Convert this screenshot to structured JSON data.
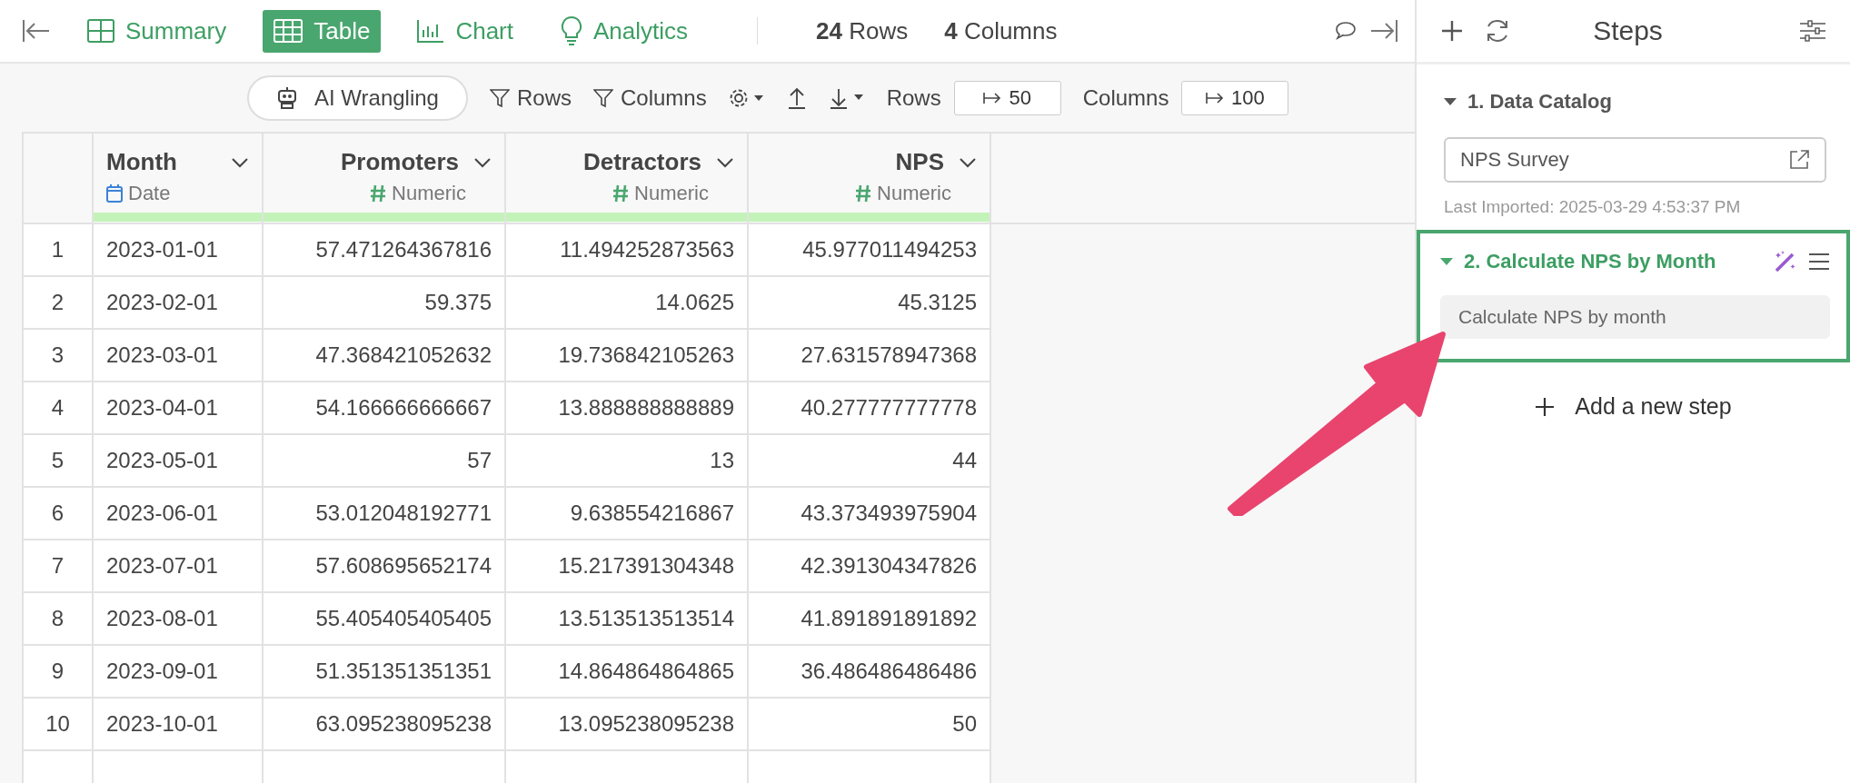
{
  "view_tabs": [
    {
      "label": "Summary",
      "kind": "summary",
      "selected": false
    },
    {
      "label": "Table",
      "kind": "table",
      "selected": true
    },
    {
      "label": "Chart",
      "kind": "chart",
      "selected": false
    },
    {
      "label": "Analytics",
      "kind": "analytics",
      "selected": false
    }
  ],
  "counts": {
    "rows_count": "24",
    "rows_label": "Rows",
    "columns_count": "4",
    "columns_label": "Columns"
  },
  "toolbar": {
    "ai_button": "AI Wrangling",
    "row_filter": "Rows",
    "column_filter": "Columns",
    "rows_label": "Rows",
    "rows_limit": "50",
    "columns_label": "Columns",
    "columns_limit": "100"
  },
  "table": {
    "columns": [
      {
        "name": "Month",
        "type": "Date",
        "kind": "date"
      },
      {
        "name": "Promoters",
        "type": "Numeric",
        "kind": "numeric"
      },
      {
        "name": "Detractors",
        "type": "Numeric",
        "kind": "numeric"
      },
      {
        "name": "NPS",
        "type": "Numeric",
        "kind": "numeric"
      }
    ],
    "rows": [
      {
        "number": "1",
        "cells": [
          "2023-01-01",
          "57.471264367816",
          "11.494252873563",
          "45.977011494253"
        ]
      },
      {
        "number": "2",
        "cells": [
          "2023-02-01",
          "59.375",
          "14.0625",
          "45.3125"
        ]
      },
      {
        "number": "3",
        "cells": [
          "2023-03-01",
          "47.368421052632",
          "19.736842105263",
          "27.631578947368"
        ]
      },
      {
        "number": "4",
        "cells": [
          "2023-04-01",
          "54.166666666667",
          "13.888888888889",
          "40.277777777778"
        ]
      },
      {
        "number": "5",
        "cells": [
          "2023-05-01",
          "57",
          "13",
          "44"
        ]
      },
      {
        "number": "6",
        "cells": [
          "2023-06-01",
          "53.012048192771",
          "9.638554216867",
          "43.373493975904"
        ]
      },
      {
        "number": "7",
        "cells": [
          "2023-07-01",
          "57.608695652174",
          "15.217391304348",
          "42.391304347826"
        ]
      },
      {
        "number": "8",
        "cells": [
          "2023-08-01",
          "55.405405405405",
          "13.513513513514",
          "41.891891891892"
        ]
      },
      {
        "number": "9",
        "cells": [
          "2023-09-01",
          "51.351351351351",
          "14.864864864865",
          "36.486486486486"
        ]
      },
      {
        "number": "10",
        "cells": [
          "2023-10-01",
          "63.095238095238",
          "13.095238095238",
          "50"
        ]
      }
    ]
  },
  "steps_panel": {
    "title": "Steps",
    "steps": [
      {
        "title": "1. Data Catalog",
        "kind": "source",
        "selected": false,
        "source": "NPS Survey",
        "note": "Last Imported: 2025-03-29 4:53:37 PM"
      },
      {
        "title": "2. Calculate NPS by Month",
        "kind": "ai",
        "selected": true,
        "description": "Calculate NPS by month"
      }
    ],
    "add_step": "Add a new step"
  }
}
